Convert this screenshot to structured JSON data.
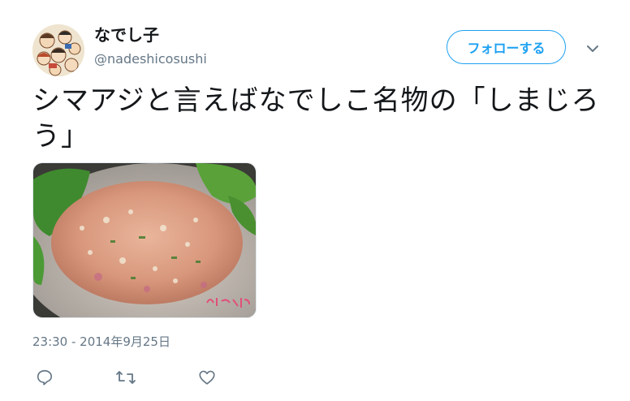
{
  "user": {
    "display_name": "なでし子",
    "handle": "@nadeshicosushi"
  },
  "header": {
    "follow_label": "フォローする"
  },
  "tweet": {
    "text": "シマアジと言えばなでしこ名物の「しまじろう」",
    "timestamp": "23:30 - 2014年9月25日"
  },
  "colors": {
    "accent": "#1da1f2",
    "secondary_text": "#657786",
    "primary_text": "#14171a"
  },
  "icons": {
    "reply": "reply-icon",
    "retweet": "retweet-icon",
    "like": "heart-icon",
    "more": "chevron-down-icon"
  }
}
